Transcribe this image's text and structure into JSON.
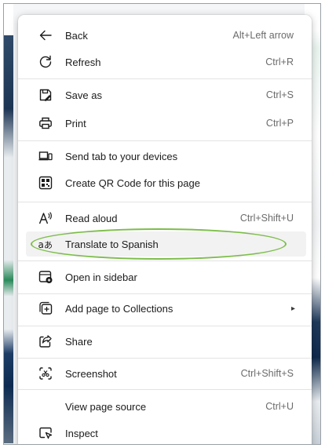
{
  "menu": {
    "items": [
      {
        "label": "Back",
        "shortcut": "Alt+Left arrow",
        "icon": "back-arrow-icon"
      },
      {
        "label": "Refresh",
        "shortcut": "Ctrl+R",
        "icon": "refresh-icon"
      },
      {
        "label": "Save as",
        "shortcut": "Ctrl+S",
        "icon": "save-icon"
      },
      {
        "label": "Print",
        "shortcut": "Ctrl+P",
        "icon": "print-icon"
      },
      {
        "label": "Send tab to your devices",
        "shortcut": "",
        "icon": "devices-icon"
      },
      {
        "label": "Create QR Code for this page",
        "shortcut": "",
        "icon": "qr-code-icon"
      },
      {
        "label": "Read aloud",
        "shortcut": "Ctrl+Shift+U",
        "icon": "read-aloud-icon"
      },
      {
        "label": "Translate to Spanish",
        "shortcut": "",
        "icon": "translate-icon"
      },
      {
        "label": "Open in sidebar",
        "shortcut": "",
        "icon": "sidebar-icon"
      },
      {
        "label": "Add page to Collections",
        "shortcut": "",
        "icon": "collections-icon",
        "submenu": "▸"
      },
      {
        "label": "Share",
        "shortcut": "",
        "icon": "share-icon"
      },
      {
        "label": "Screenshot",
        "shortcut": "Ctrl+Shift+S",
        "icon": "screenshot-icon"
      },
      {
        "label": "View page source",
        "shortcut": "Ctrl+U",
        "icon": ""
      },
      {
        "label": "Inspect",
        "shortcut": "",
        "icon": "inspect-icon"
      }
    ],
    "highlighted": "Translate to Spanish",
    "annotation_color": "#7dbd4a"
  }
}
